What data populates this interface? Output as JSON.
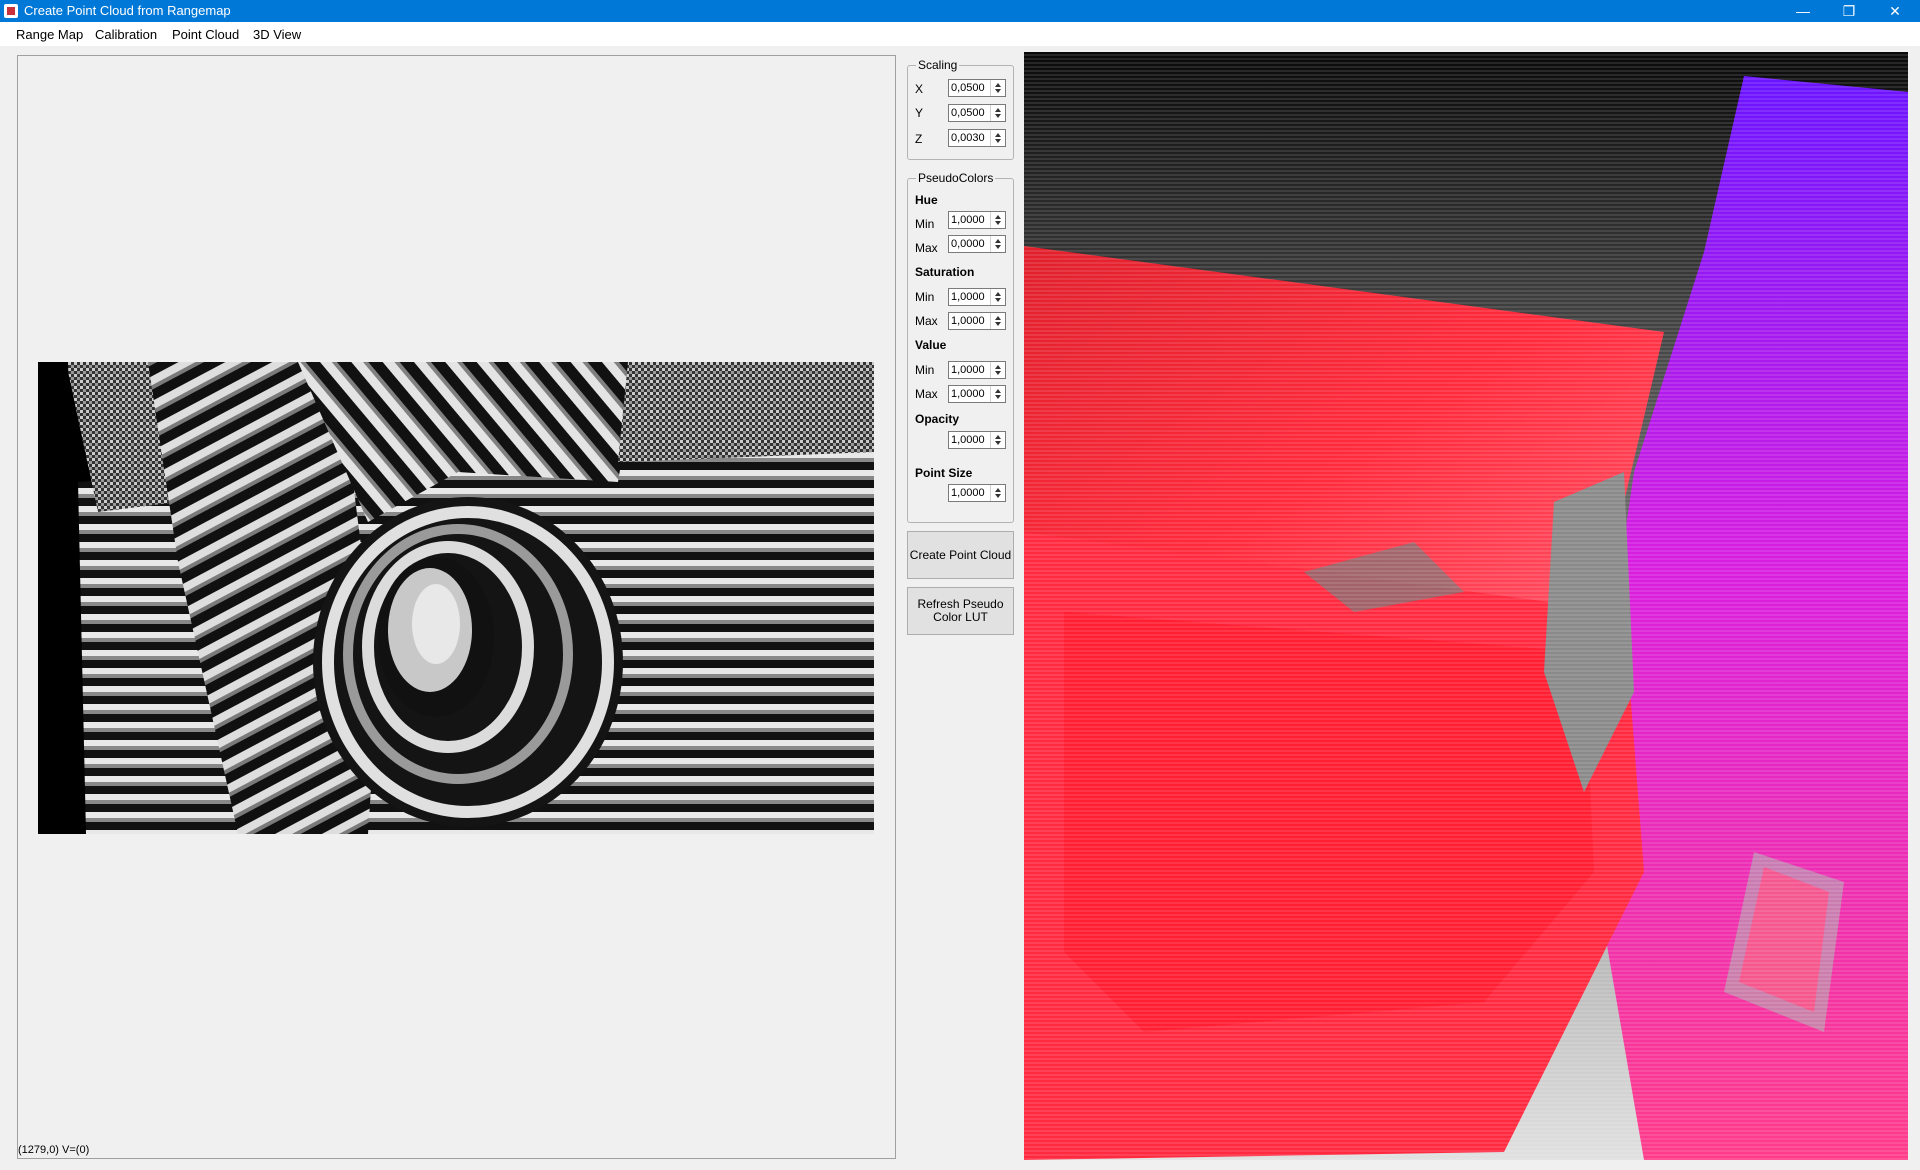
{
  "window": {
    "title": "Create Point Cloud from Rangemap",
    "controls": {
      "minimize": "—",
      "restore": "❐",
      "close": "✕"
    }
  },
  "menu": [
    "Range Map",
    "Calibration",
    "Point Cloud",
    "3D View"
  ],
  "status": {
    "text": "(1279,0)  V=(0)"
  },
  "scaling": {
    "legend": "Scaling",
    "x_label": "X",
    "x_value": "0,0500",
    "y_label": "Y",
    "y_value": "0,0500",
    "z_label": "Z",
    "z_value": "0,0030"
  },
  "pseudocolors": {
    "legend": "PseudoColors",
    "hue": {
      "header": "Hue",
      "min_label": "Min",
      "min_value": "1,0000",
      "max_label": "Max",
      "max_value": "0,0000"
    },
    "saturation": {
      "header": "Saturation",
      "min_label": "Min",
      "min_value": "1,0000",
      "max_label": "Max",
      "max_value": "1,0000"
    },
    "value": {
      "header": "Value",
      "min_label": "Min",
      "min_value": "1,0000",
      "max_label": "Max",
      "max_value": "1,0000"
    },
    "opacity": {
      "header": "Opacity",
      "value": "1,0000"
    },
    "point_size": {
      "header": "Point Size",
      "value": "1,0000"
    }
  },
  "buttons": {
    "create": "Create Point Cloud",
    "refresh_line1": "Refresh Pseudo",
    "refresh_line2": "Color LUT"
  },
  "colors": {
    "titlebar": "#0078d7",
    "red_surface": "#ff1e32",
    "violet_surface": "#7a18ff",
    "background_gray": "#8a8a8a"
  },
  "icons": {
    "app": "app-icon"
  }
}
